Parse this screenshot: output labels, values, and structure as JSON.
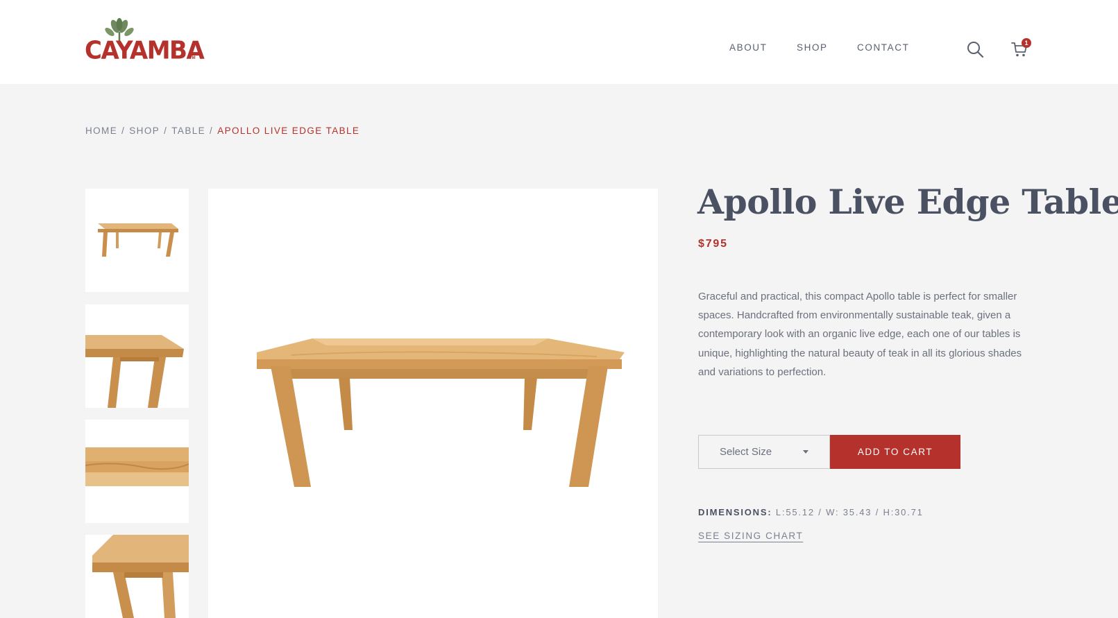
{
  "brand": {
    "name": "CAYAMBA",
    "trademark": "TM",
    "color": "#b5312b"
  },
  "nav": {
    "items": [
      {
        "label": "ABOUT"
      },
      {
        "label": "SHOP"
      },
      {
        "label": "CONTACT"
      }
    ],
    "search_icon": "search-icon",
    "cart_icon": "cart-icon",
    "cart_count": "1"
  },
  "breadcrumb": {
    "items": [
      "HOME",
      "SHOP",
      "TABLE"
    ],
    "separator": "/",
    "current": "APOLLO LIVE EDGE TABLE"
  },
  "gallery": {
    "thumbnails": [
      {
        "name": "thumbnail-full-table"
      },
      {
        "name": "thumbnail-table-corner"
      },
      {
        "name": "thumbnail-table-edge"
      },
      {
        "name": "thumbnail-table-leg"
      }
    ]
  },
  "product": {
    "title": "Apollo Live Edge Table",
    "price": "$795",
    "description": "Graceful and practical, this compact Apollo table is perfect for smaller spaces.  Handcrafted from environmentally sustainable teak, given a contemporary look with an organic live edge, each one of our tables is unique, highlighting the natural beauty of teak in all its glorious shades and variations to perfection.",
    "size_select": {
      "placeholder": "Select Size"
    },
    "add_to_cart_label": "ADD TO CART",
    "dimensions_label": "DIMENSIONS:",
    "dimensions_value": "L:55.12 / W: 35.43 / H:30.71",
    "sizing_chart_link": "SEE SIZING CHART"
  },
  "colors": {
    "accent": "#b5312b",
    "page_bg": "#f4f4f4",
    "text": "#4a5162",
    "wood": "#d9a867"
  }
}
